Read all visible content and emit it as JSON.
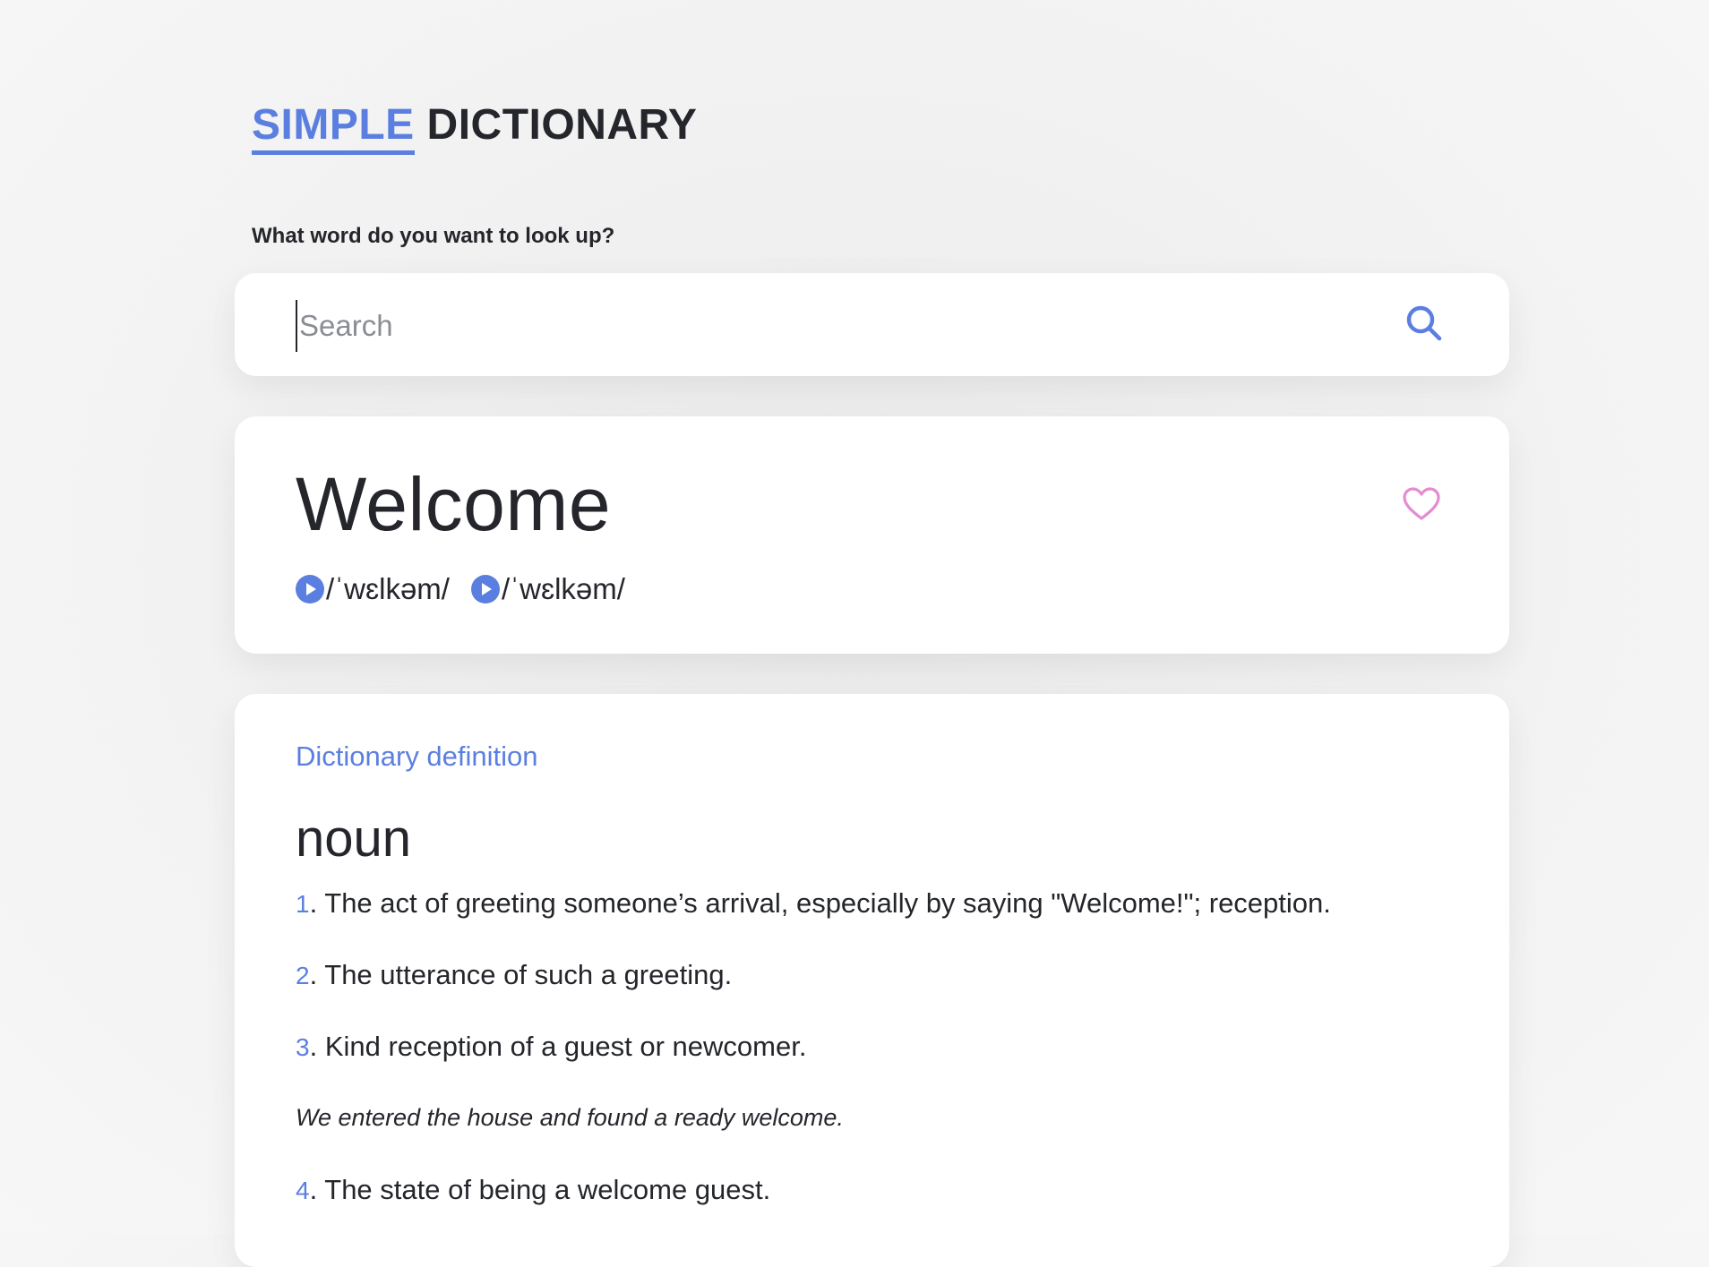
{
  "header": {
    "logo_accent": "SIMPLE",
    "logo_rest": "DICTIONARY",
    "prompt": "What word do you want to look up?"
  },
  "search": {
    "placeholder": "Search",
    "value": ""
  },
  "entry": {
    "word": "Welcome",
    "phonetics": [
      "/ˈwɛlkəm/",
      "/ˈwɛlkəm/"
    ]
  },
  "definition_section": {
    "label": "Dictionary definition",
    "part_of_speech": "noun",
    "definitions": [
      {
        "number": "1",
        "text": " The act of greeting someone’s arrival, especially by saying \"Welcome!\"; reception."
      },
      {
        "number": "2",
        "text": " The utterance of such a greeting."
      },
      {
        "number": "3",
        "text": " Kind reception of a guest or newcomer."
      },
      {
        "number": "4",
        "text": " The state of being a welcome guest."
      }
    ],
    "example": "We entered the house and found a ready welcome."
  },
  "colors": {
    "accent": "#5b7fe0",
    "favorite": "#e58bd0",
    "text": "#24262b"
  },
  "icons": {
    "search": "search-icon",
    "favorite": "heart-icon",
    "play": "play-icon"
  }
}
